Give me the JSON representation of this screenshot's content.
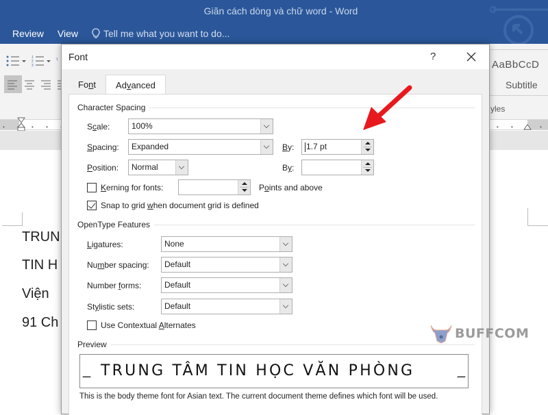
{
  "app": {
    "title": "Giãn cách dòng và chữ word - Word",
    "menu": [
      "Review",
      "View"
    ],
    "tell_me": "Tell me what you want to do..."
  },
  "ribbon": {
    "style_sample": "AaBbCcD",
    "style_name": "Subtitle",
    "styles_group_label": "yles"
  },
  "document": {
    "lines": [
      "TRUN",
      "TIN H",
      "Viện",
      "91 Ch"
    ]
  },
  "dialog": {
    "title": "Font",
    "help_label": "?",
    "tabs": [
      {
        "label_pre": "Fo",
        "label_u": "n",
        "label_post": "t",
        "active": false
      },
      {
        "label_pre": "Ad",
        "label_u": "v",
        "label_post": "anced",
        "active": true
      }
    ],
    "character_spacing": {
      "heading": "Character Spacing",
      "scale": {
        "label_pre": "S",
        "label_u": "c",
        "label_post": "ale:",
        "value": "100%"
      },
      "spacing": {
        "label_u": "S",
        "label_post": "pacing:",
        "value": "Expanded"
      },
      "spacing_by": {
        "label_u": "B",
        "label_post": "y:",
        "value": "1.7 pt"
      },
      "position": {
        "label_u": "P",
        "label_post": "osition:",
        "value": "Normal"
      },
      "position_by": {
        "label_pre": "B",
        "label_u": "y",
        "label_post": ":",
        "value": ""
      },
      "kerning": {
        "label_u": "K",
        "label_post": "erning for fonts:",
        "checked": false,
        "value": "",
        "suffix_pre": "P",
        "suffix_u": "o",
        "suffix_post": "ints and above"
      },
      "snap": {
        "label_pre": "Snap to grid ",
        "label_u": "w",
        "label_post": "hen document grid is defined",
        "checked": true
      }
    },
    "opentype": {
      "heading": "OpenType Features",
      "ligatures": {
        "label_u": "L",
        "label_post": "igatures:",
        "value": "None"
      },
      "number_spacing": {
        "label_pre": "Nu",
        "label_u": "m",
        "label_post": "ber spacing:",
        "value": "Default"
      },
      "number_forms": {
        "label_pre": "Number ",
        "label_u": "f",
        "label_post": "orms:",
        "value": "Default"
      },
      "stylistic_sets": {
        "label_pre": "St",
        "label_u": "y",
        "label_post": "listic sets:",
        "value": "Default"
      },
      "contextual": {
        "label_pre": "Use Contextual ",
        "label_u": "A",
        "label_post": "lternates",
        "checked": false
      }
    },
    "preview": {
      "heading": "Preview",
      "text": "TRUNG TÂM TIN HỌC VĂN PHÒNG",
      "note": "This is the body theme font for Asian text. The current document theme defines which font will be used."
    }
  },
  "watermark": {
    "text": "BUFFCOM"
  },
  "colors": {
    "title_bar": "#2b579a",
    "annotation_arrow": "#e8191e"
  }
}
